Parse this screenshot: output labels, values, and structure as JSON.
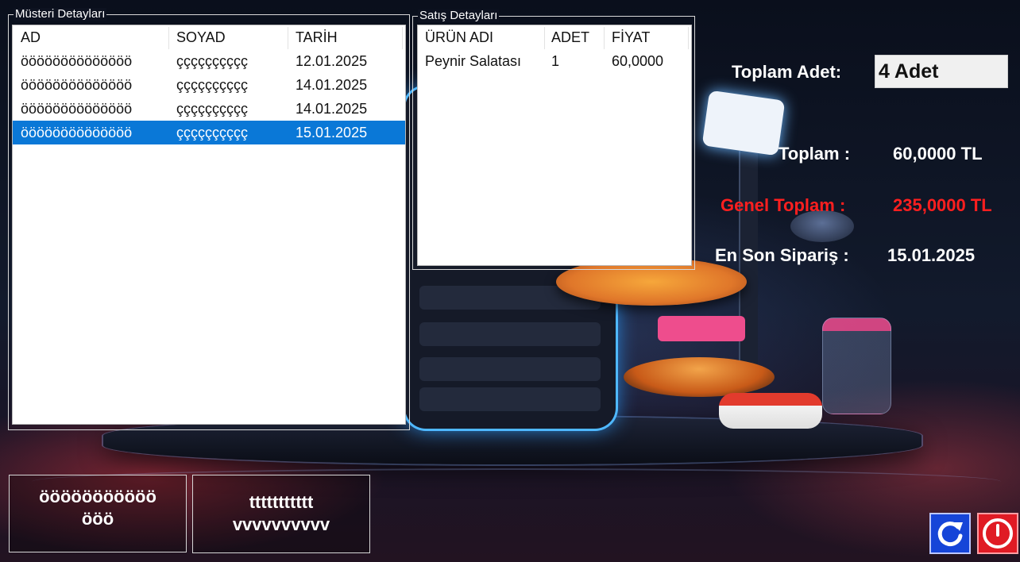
{
  "customers_group": {
    "title": "Müsteri Detayları",
    "columns": [
      "AD",
      "SOYAD",
      "TARİH"
    ],
    "rows": [
      {
        "ad": "öööööööööööööö",
        "soyad": "çççççççççç",
        "tarih": "12.01.2025"
      },
      {
        "ad": "öööööööööööööö",
        "soyad": "çççççççççç",
        "tarih": "14.01.2025"
      },
      {
        "ad": "öööööööööööööö",
        "soyad": "çççççççççç",
        "tarih": "14.01.2025"
      },
      {
        "ad": "öööööööööööööö",
        "soyad": "çççççççççç",
        "tarih": "15.01.2025"
      }
    ],
    "selected_row": 3
  },
  "sales_group": {
    "title": "Satış Detayları",
    "columns": [
      "ÜRÜN ADI",
      "ADET",
      "FİYAT"
    ],
    "rows": [
      {
        "urun": "Peynir Salatası",
        "adet": "1",
        "fiyat": "60,0000"
      }
    ]
  },
  "summary": {
    "toplam_adet_label": "Toplam Adet:",
    "toplam_adet_value": "4 Adet",
    "toplam_label": "Toplam :",
    "toplam_value": "60,0000 TL",
    "genel_toplam_label": "Genel Toplam :",
    "genel_toplam_value": "235,0000 TL",
    "son_siparis_label": "En Son Sipariş :",
    "son_siparis_value": "15.01.2025"
  },
  "buttons": {
    "left_line1": "ööööööööööö",
    "left_line2": "ööö",
    "right_line1": "ttttttttttt",
    "right_line2": "vvvvvvvvvv"
  },
  "icons": {
    "refresh": "refresh-icon",
    "power": "power-icon"
  },
  "colors": {
    "selection": "#0a78d7",
    "red_text": "#ff1f1f",
    "refresh_bg": "#1645d8",
    "power_bg": "#e01b24"
  }
}
